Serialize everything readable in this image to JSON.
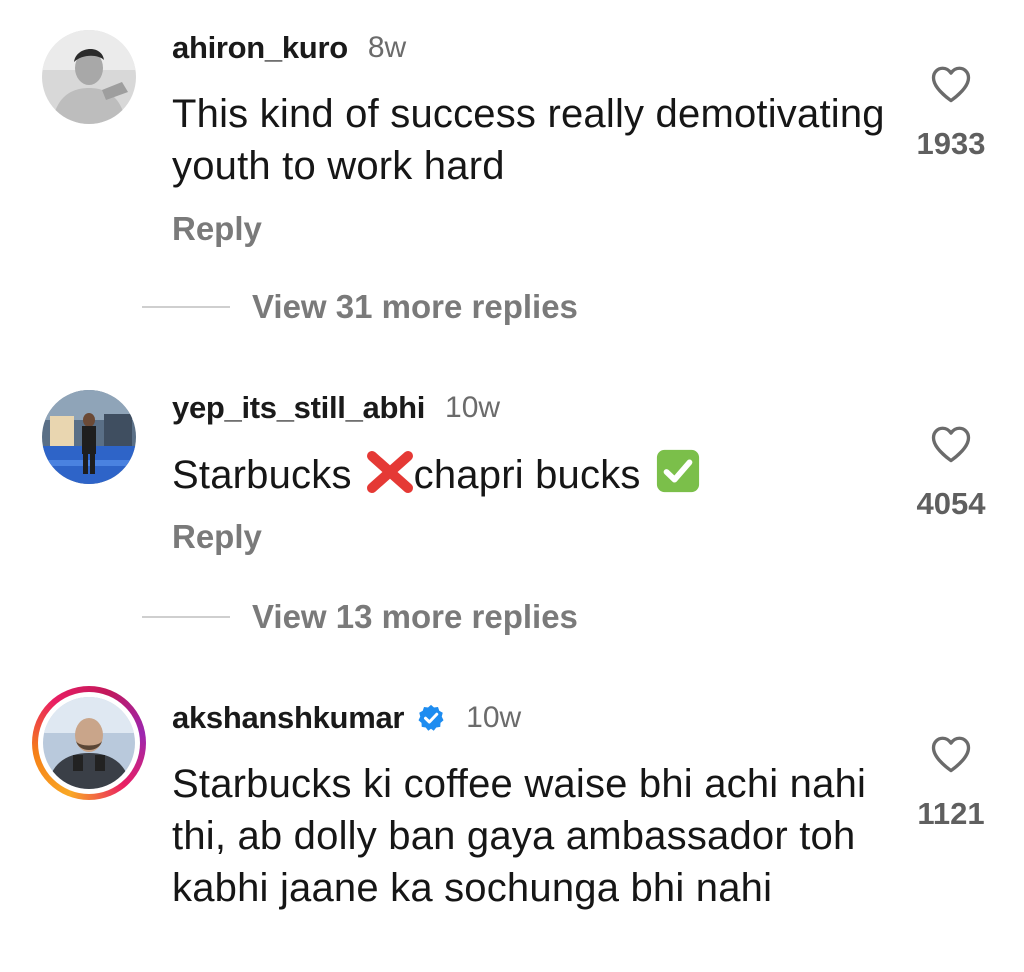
{
  "colors": {
    "username": "#1a1a1a",
    "time": "#6b6b6b",
    "secondary": "#7a7a7a",
    "verified": "#1d8cf0",
    "emoji_x": "#e53935",
    "emoji_check": "#7bbf4a",
    "story_ring": [
      "#f9a825",
      "#e91e63",
      "#9c27b0"
    ]
  },
  "comments": [
    {
      "username": "ahiron_kuro",
      "time": "8w",
      "text": "This kind of success really demotivating youth to work hard",
      "reply_label": "Reply",
      "likes": "1933",
      "view_more": "View 31 more replies",
      "avatar_icon": "avatar-photo-icon"
    },
    {
      "username": "yep_its_still_abhi",
      "time": "10w",
      "text_part1": "Starbucks",
      "text_part2": "chapri bucks",
      "emoji_1": "cross-mark-emoji-icon",
      "emoji_2": "check-mark-emoji-icon",
      "reply_label": "Reply",
      "likes": "4054",
      "view_more": "View 13 more replies",
      "avatar_icon": "avatar-photo-icon"
    },
    {
      "username": "akshanshkumar",
      "verified": true,
      "time": "10w",
      "text": "Starbucks ki coffee waise bhi achi nahi thi, ab dolly ban gaya ambassador toh kabhi jaane ka sochunga bhi nahi",
      "likes": "1121",
      "avatar_icon": "avatar-photo-icon"
    }
  ]
}
